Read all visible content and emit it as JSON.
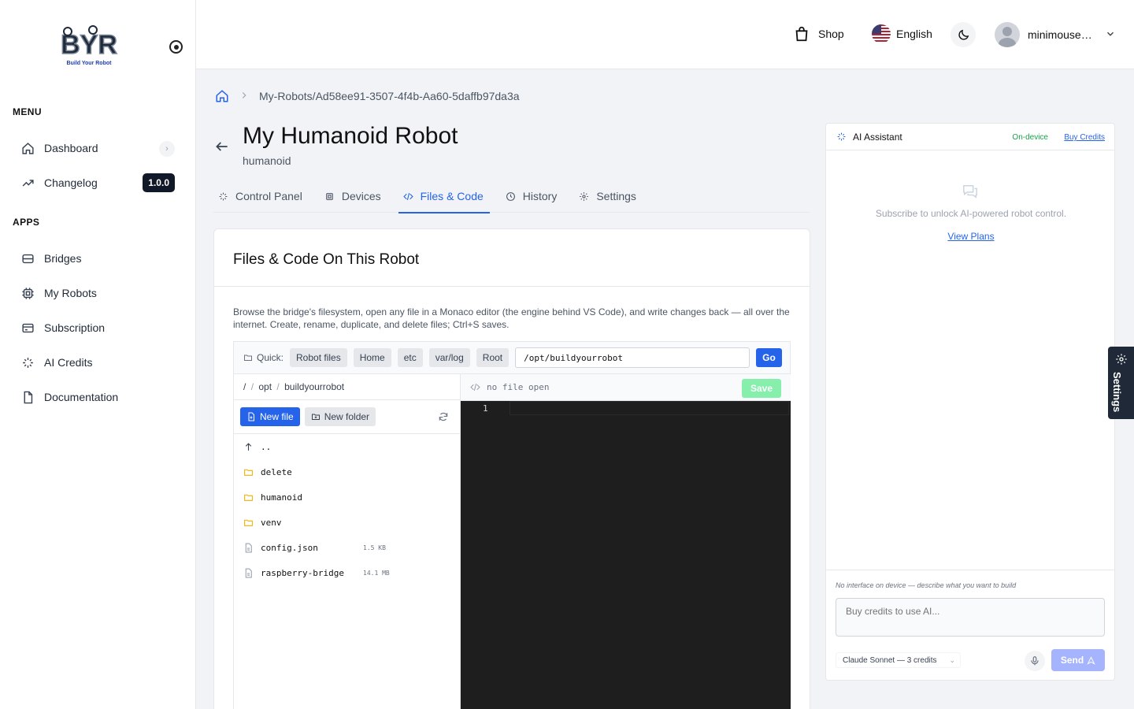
{
  "sidebar": {
    "logo_text": "BYR",
    "logo_tagline": "Build Your Robot",
    "menu_label": "MENU",
    "apps_label": "APPS",
    "menu_items": [
      {
        "label": "Dashboard",
        "icon": "home-icon"
      },
      {
        "label": "Changelog",
        "icon": "trending-icon",
        "badge": "1.0.0"
      }
    ],
    "app_items": [
      {
        "label": "Bridges",
        "icon": "bridge-icon"
      },
      {
        "label": "My Robots",
        "icon": "chip-icon"
      },
      {
        "label": "Subscription",
        "icon": "card-icon"
      },
      {
        "label": "AI Credits",
        "icon": "sparkle-icon"
      },
      {
        "label": "Documentation",
        "icon": "file-icon"
      }
    ]
  },
  "topbar": {
    "shop_label": "Shop",
    "language_label": "English",
    "username": "minimouse…"
  },
  "breadcrumb": {
    "path": "My-Robots/Ad58ee91-3507-4f4b-Aa60-5daffb97da3a"
  },
  "robot": {
    "title": "My Humanoid Robot",
    "subtitle": "humanoid"
  },
  "tabs": [
    {
      "label": "Control Panel",
      "icon": "sparkle-icon"
    },
    {
      "label": "Devices",
      "icon": "chip-icon"
    },
    {
      "label": "Files & Code",
      "icon": "code-icon",
      "active": true
    },
    {
      "label": "History",
      "icon": "clock-icon"
    },
    {
      "label": "Settings",
      "icon": "gear-icon"
    }
  ],
  "files_card": {
    "title": "Files & Code On This Robot",
    "description": "Browse the bridge's filesystem, open any file in a Monaco editor (the engine behind VS Code), and write changes back — all over the internet. Create, rename, duplicate, and delete files; Ctrl+S saves.",
    "quick_label": "Quick:",
    "quick_buttons": [
      "Robot files",
      "Home",
      "etc",
      "var/log",
      "Root"
    ],
    "path_value": "/opt/buildyourrobot",
    "go_label": "Go",
    "crumbs": [
      "/",
      "/",
      "opt",
      "/",
      "buildyourrobot"
    ],
    "new_file_label": "New file",
    "new_folder_label": "New folder",
    "entries": [
      {
        "name": "..",
        "type": "up"
      },
      {
        "name": "delete",
        "type": "folder"
      },
      {
        "name": "humanoid",
        "type": "folder"
      },
      {
        "name": "venv",
        "type": "folder"
      },
      {
        "name": "config.json",
        "type": "file",
        "size": "1.5 KB"
      },
      {
        "name": "raspberry-bridge",
        "type": "file",
        "size": "14.1 MB"
      }
    ],
    "editor_status": "no file open",
    "save_label": "Save",
    "line_number": "1"
  },
  "ai_panel": {
    "title": "AI Assistant",
    "status": "On-device",
    "buy_credits": "Buy Credits",
    "empty_message": "Subscribe to unlock AI-powered robot control.",
    "view_plans": "View Plans",
    "hint": "No interface on device — describe what you want to build",
    "input_placeholder": "Buy credits to use AI...",
    "model_label": "Claude Sonnet — 3 credits",
    "send_label": "Send"
  },
  "settings_tab_label": "Settings",
  "colors": {
    "accent": "#2563eb",
    "save_disabled": "#86efac",
    "send_disabled": "#a5b4fc",
    "editor_bg": "#1e1e1e"
  }
}
